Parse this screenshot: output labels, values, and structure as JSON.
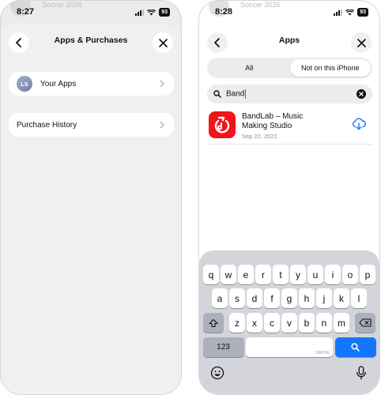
{
  "left": {
    "status": {
      "time": "8:27",
      "battery": "93",
      "ghost_text": "Soccer 2026"
    },
    "sheet": {
      "title": "Apps & Purchases",
      "your_apps": {
        "avatar": "LS",
        "label": "Your Apps"
      },
      "purchase_history": {
        "label": "Purchase History"
      }
    }
  },
  "right": {
    "status": {
      "time": "8:28",
      "battery": "93",
      "ghost_text": "Soccer 2026"
    },
    "sheet": {
      "title": "Apps",
      "segments": [
        {
          "label": "All"
        },
        {
          "label": "Not on this iPhone",
          "selected": true
        }
      ],
      "search": {
        "query": "Band"
      },
      "result": {
        "name_line1": "BandLab – Music",
        "name_line2": "Making Studio",
        "date": "Sep 22, 2022",
        "icon": "bandlab-logo-icon"
      }
    },
    "keyboard": {
      "row1": [
        "q",
        "w",
        "e",
        "r",
        "t",
        "y",
        "u",
        "i",
        "o",
        "p"
      ],
      "row2": [
        "a",
        "s",
        "d",
        "f",
        "g",
        "h",
        "j",
        "k",
        "l"
      ],
      "row3": [
        "z",
        "x",
        "c",
        "v",
        "b",
        "n",
        "m"
      ],
      "numbers_label": "123",
      "space_sublabel": "SWYPE",
      "icons": {
        "shift": "shift-icon",
        "delete": "delete-icon",
        "search": "search-icon",
        "emoji": "emoji-icon",
        "mic": "microphone-icon"
      }
    }
  },
  "colors": {
    "accent": "#1476ff",
    "bandlab_red": "#f2141a",
    "keyboard_bg": "#d3d5db"
  }
}
